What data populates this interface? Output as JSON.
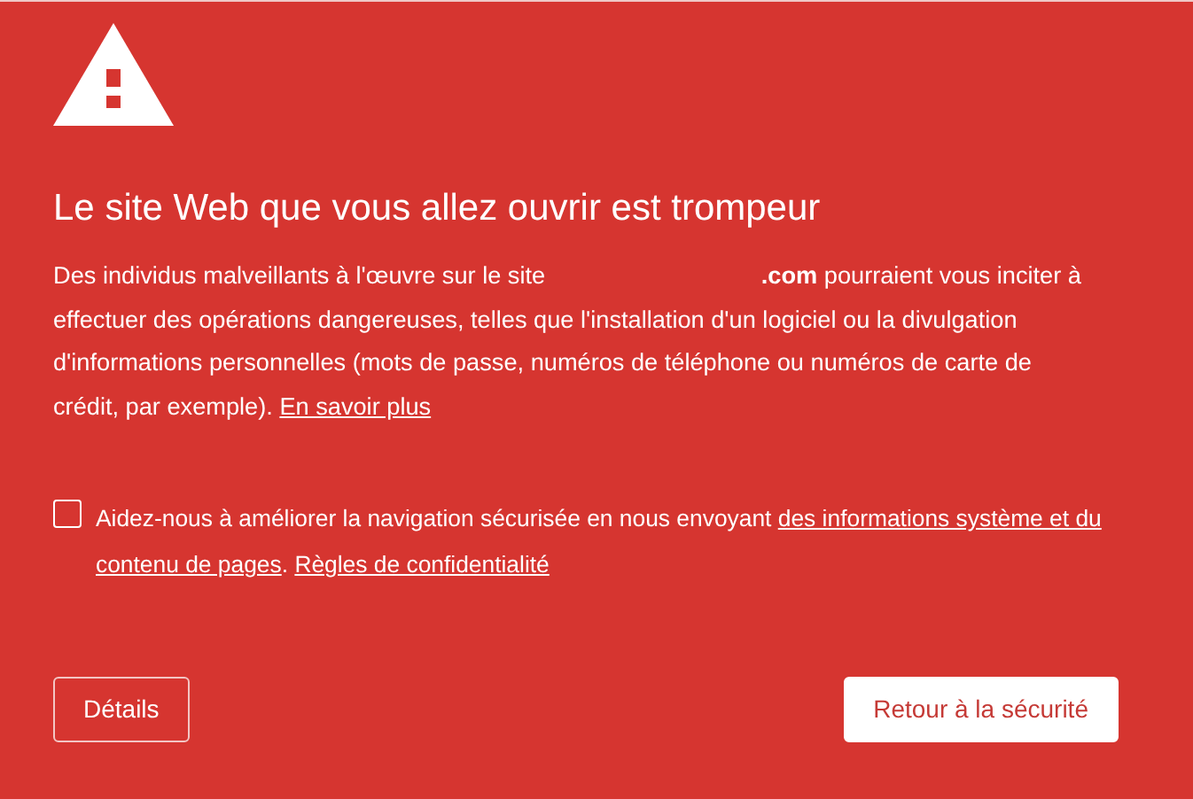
{
  "title": "Le site Web que vous allez ouvrir est trompeur",
  "description": {
    "before": "Des individus malveillants à l'œuvre sur le site",
    "domain": ".com",
    "after": "pourraient vous inciter à effectuer des opérations dangereuses, telles que l'installation d'un logiciel ou la divulgation d'informations personnelles (mots de passe, numéros de téléphone ou numéros de carte de crédit, par exemple).",
    "link": "En savoir plus"
  },
  "checkbox": {
    "checked": false,
    "text": "Aidez-nous à améliorer la navigation sécurisée en nous envoyant",
    "link_lines": [
      "des informations système et du",
      "contenu de pages"
    ],
    "separator": ".",
    "policy_link": "Règles de confidentialité"
  },
  "buttons": [
    {
      "label": "Détails",
      "kind": "secondary"
    },
    {
      "label": "Retour à la sécurité",
      "kind": "primary"
    }
  ]
}
